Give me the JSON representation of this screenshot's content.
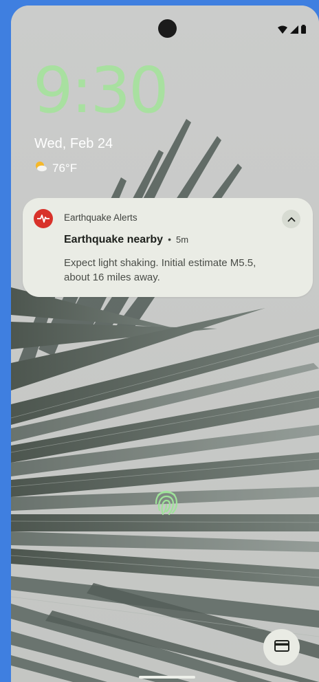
{
  "lock_screen": {
    "time": "9:30",
    "date": "Wed, Feb 24",
    "weather": {
      "temperature": "76°F",
      "icon": "partly-cloudy-icon"
    }
  },
  "status_bar": {
    "icons": [
      "wifi-icon",
      "cellular-signal-icon",
      "battery-icon"
    ]
  },
  "notification": {
    "app_name": "Earthquake Alerts",
    "app_icon": "earthquake-alert-icon",
    "title": "Earthquake nearby",
    "separator": "•",
    "time": "5m",
    "body": "Expect light shaking. Initial estimate M5.5, about 16 miles away.",
    "expand_icon": "chevron-up-icon"
  },
  "bottom_controls": {
    "fingerprint_icon": "fingerprint-icon",
    "wallet_icon": "wallet-card-icon"
  },
  "colors": {
    "clock": "#a8e0a0",
    "notification_bg": "#eaece5",
    "alert_red": "#d8322a",
    "frame_blue": "#3f7fe0"
  }
}
